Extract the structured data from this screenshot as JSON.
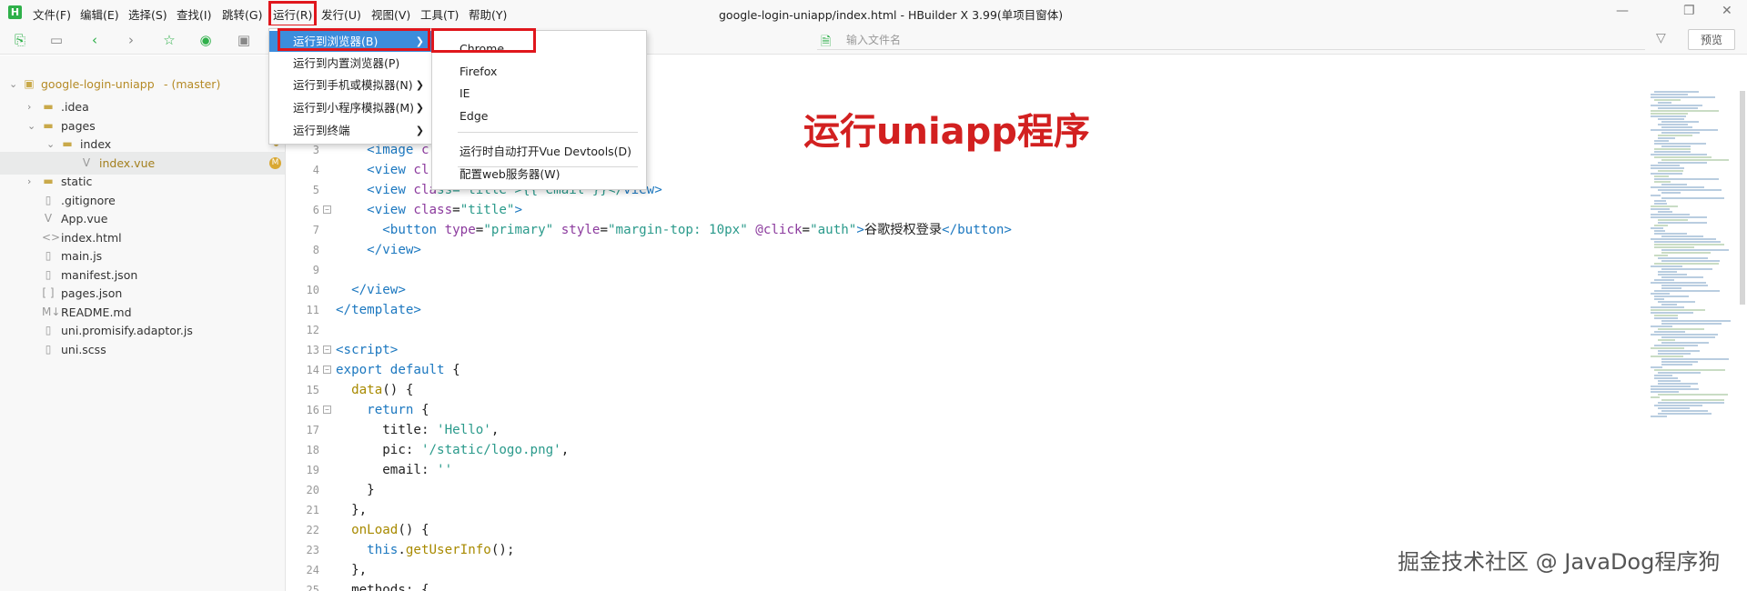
{
  "app": {
    "logo": "H",
    "title": "google-login-uniapp/index.html - HBuilder X 3.99(单项目窗体)"
  },
  "menubar": {
    "items": [
      "文件(F)",
      "编辑(E)",
      "选择(S)",
      "查找(I)",
      "跳转(G)",
      "运行(R)",
      "发行(U)",
      "视图(V)",
      "工具(T)",
      "帮助(Y)"
    ]
  },
  "window_controls": {
    "minimize": "—",
    "restore": "❐",
    "close": "✕"
  },
  "toolbar": {
    "file_search_placeholder": "输入文件名",
    "preview_label": "预览"
  },
  "run_menu": {
    "items": [
      {
        "label": "运行到浏览器(B)",
        "has_submenu": true,
        "active": true
      },
      {
        "label": "运行到内置浏览器(P)",
        "has_submenu": false
      },
      {
        "label": "运行到手机或模拟器(N)",
        "has_submenu": true
      },
      {
        "label": "运行到小程序模拟器(M)",
        "has_submenu": true
      },
      {
        "label": "运行到终端",
        "has_submenu": true
      }
    ],
    "browser_submenu": {
      "items": [
        "Chrome",
        "Firefox",
        "IE",
        "Edge"
      ],
      "devtools": "运行时自动打开Vue Devtools(D)",
      "webserver": "配置web服务器(W)"
    }
  },
  "sidebar": {
    "root": {
      "name": "google-login-uniapp",
      "branch": "- (master)"
    },
    "tree": [
      {
        "label": ".idea",
        "type": "folder",
        "depth": 1,
        "expanded": false
      },
      {
        "label": "pages",
        "type": "folder",
        "depth": 1,
        "expanded": true,
        "modified": true
      },
      {
        "label": "index",
        "type": "folder",
        "depth": 2,
        "expanded": true,
        "modified": true
      },
      {
        "label": "index.vue",
        "type": "vue",
        "depth": 3,
        "selected": true,
        "badge": "M"
      },
      {
        "label": "static",
        "type": "folder",
        "depth": 1,
        "expanded": false
      },
      {
        "label": ".gitignore",
        "type": "file",
        "depth": 1
      },
      {
        "label": "App.vue",
        "type": "vue",
        "depth": 1
      },
      {
        "label": "index.html",
        "type": "html",
        "depth": 1
      },
      {
        "label": "main.js",
        "type": "file",
        "depth": 1
      },
      {
        "label": "manifest.json",
        "type": "file",
        "depth": 1
      },
      {
        "label": "pages.json",
        "type": "json",
        "depth": 1
      },
      {
        "label": "README.md",
        "type": "md",
        "depth": 1
      },
      {
        "label": "uni.promisify.adaptor.js",
        "type": "file",
        "depth": 1
      },
      {
        "label": "uni.scss",
        "type": "file",
        "depth": 1
      }
    ]
  },
  "editor": {
    "lines": [
      {
        "n": "3",
        "indent": 2,
        "tokens": [
          [
            "tag",
            "<image "
          ],
          [
            "attr",
            "c"
          ]
        ]
      },
      {
        "n": "4",
        "indent": 2,
        "tokens": [
          [
            "tag",
            "<view "
          ],
          [
            "attr",
            "cl"
          ],
          [
            "txt",
            "                  "
          ],
          [
            "tag",
            "iew>"
          ]
        ]
      },
      {
        "n": "5",
        "indent": 2,
        "tokens": [
          [
            "tag",
            "<view "
          ],
          [
            "attr",
            "cla"
          ],
          [
            "str",
            "ss=\"title\">{{ email }}</"
          ],
          [
            "tag",
            "view>"
          ]
        ]
      },
      {
        "n": "6",
        "indent": 2,
        "fold": true,
        "tokens": [
          [
            "tag",
            "<view "
          ],
          [
            "attr",
            "class"
          ],
          [
            "punct",
            "="
          ],
          [
            "str",
            "\"title\""
          ],
          [
            "tag",
            ">"
          ]
        ]
      },
      {
        "n": "7",
        "indent": 3,
        "tokens": [
          [
            "tag",
            "<button "
          ],
          [
            "attr",
            "type"
          ],
          [
            "punct",
            "="
          ],
          [
            "str",
            "\"primary\" "
          ],
          [
            "attr",
            "style"
          ],
          [
            "punct",
            "="
          ],
          [
            "str",
            "\"margin-top: 10px\" "
          ],
          [
            "attr",
            "@click"
          ],
          [
            "punct",
            "="
          ],
          [
            "str",
            "\"auth\""
          ],
          [
            "tag",
            ">"
          ],
          [
            "txt",
            "谷歌授权登录"
          ],
          [
            "tag",
            "</button>"
          ]
        ]
      },
      {
        "n": "8",
        "indent": 2,
        "tokens": [
          [
            "tag",
            "</view>"
          ]
        ]
      },
      {
        "n": "9",
        "indent": 0,
        "tokens": []
      },
      {
        "n": "10",
        "indent": 1,
        "tokens": [
          [
            "tag",
            "</view>"
          ]
        ]
      },
      {
        "n": "11",
        "indent": 0,
        "tokens": [
          [
            "tag",
            "</template>"
          ]
        ]
      },
      {
        "n": "12",
        "indent": 0,
        "tokens": []
      },
      {
        "n": "13",
        "indent": 0,
        "fold": true,
        "tokens": [
          [
            "tag",
            "<script>"
          ]
        ]
      },
      {
        "n": "14",
        "indent": 0,
        "fold": true,
        "tokens": [
          [
            "kw",
            "export default "
          ],
          [
            "punct",
            "{"
          ]
        ]
      },
      {
        "n": "15",
        "indent": 1,
        "tokens": [
          [
            "fn",
            "data"
          ],
          [
            "punct",
            "() {"
          ]
        ]
      },
      {
        "n": "16",
        "indent": 2,
        "fold": true,
        "tokens": [
          [
            "kw",
            "return "
          ],
          [
            "punct",
            "{"
          ]
        ]
      },
      {
        "n": "17",
        "indent": 3,
        "tokens": [
          [
            "txt",
            "title: "
          ],
          [
            "str",
            "'Hello'"
          ],
          [
            "punct",
            ","
          ]
        ]
      },
      {
        "n": "18",
        "indent": 3,
        "tokens": [
          [
            "txt",
            "pic: "
          ],
          [
            "str",
            "'/static/logo.png'"
          ],
          [
            "punct",
            ","
          ]
        ]
      },
      {
        "n": "19",
        "indent": 3,
        "tokens": [
          [
            "txt",
            "email: "
          ],
          [
            "str",
            "''"
          ]
        ]
      },
      {
        "n": "20",
        "indent": 2,
        "tokens": [
          [
            "punct",
            "}"
          ]
        ]
      },
      {
        "n": "21",
        "indent": 1,
        "tokens": [
          [
            "punct",
            "},"
          ]
        ]
      },
      {
        "n": "22",
        "indent": 1,
        "tokens": [
          [
            "fn",
            "onLoad"
          ],
          [
            "punct",
            "() {"
          ]
        ]
      },
      {
        "n": "23",
        "indent": 2,
        "tokens": [
          [
            "kw",
            "this"
          ],
          [
            "punct",
            "."
          ],
          [
            "fn",
            "getUserInfo"
          ],
          [
            "punct",
            "();"
          ]
        ]
      },
      {
        "n": "24",
        "indent": 1,
        "tokens": [
          [
            "punct",
            "},"
          ]
        ]
      },
      {
        "n": "25",
        "indent": 1,
        "tokens": [
          [
            "txt",
            "methods: "
          ],
          [
            "punct",
            "{"
          ]
        ]
      }
    ]
  },
  "overlay_title": "运行uniapp程序",
  "watermark": "掘金技术社区 @ JavaDog程序狗",
  "colors": {
    "highlight_border": "#e0161c",
    "menu_active": "#3c8ddc",
    "accent_green": "#2fb04a"
  }
}
